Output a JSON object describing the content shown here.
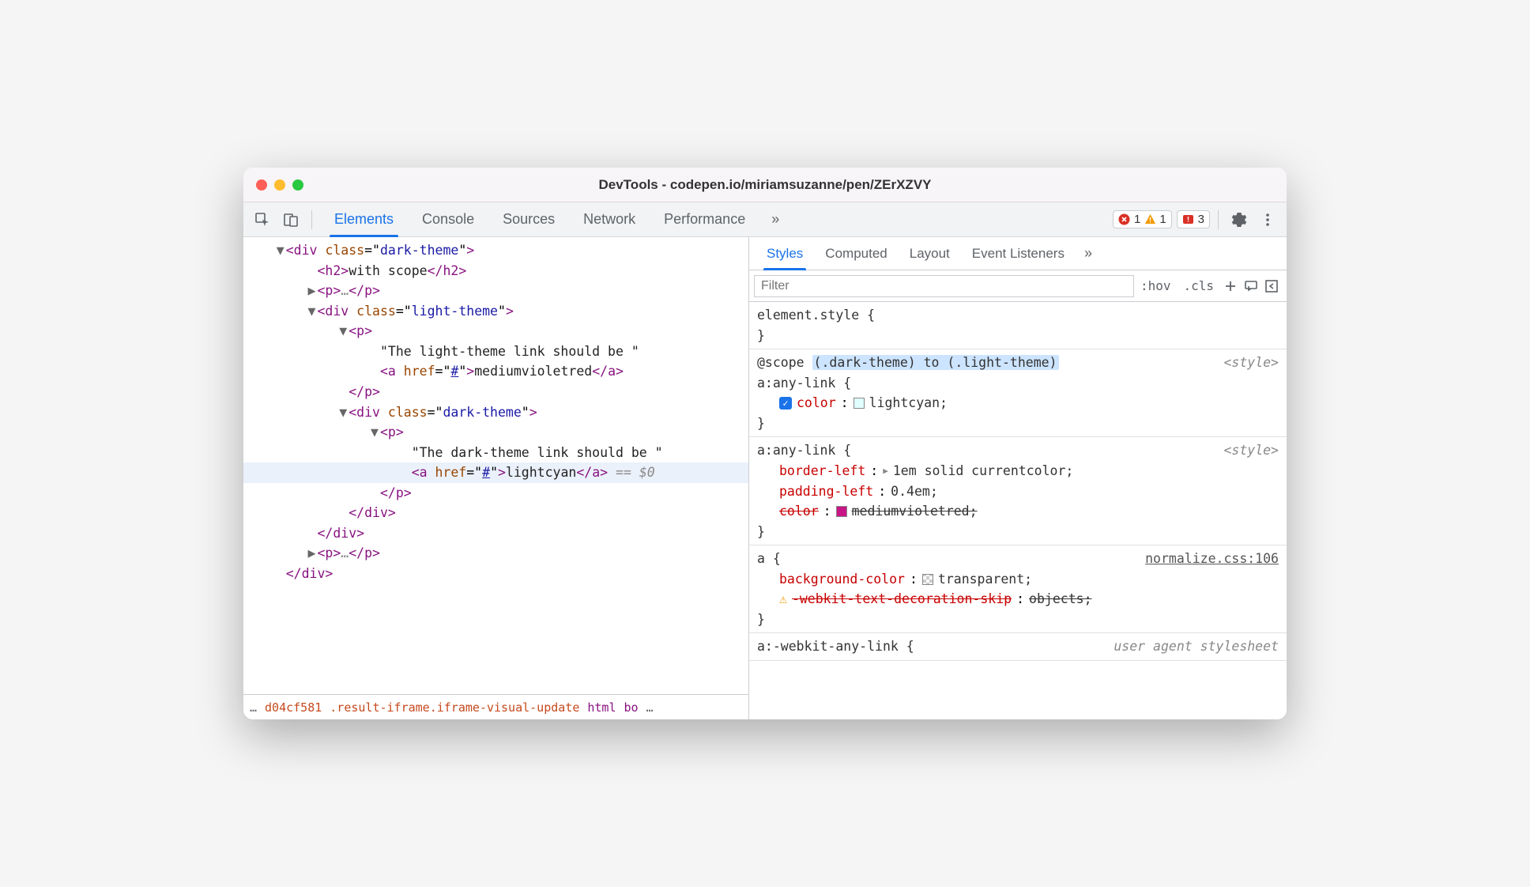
{
  "titlebar": {
    "title": "DevTools - codepen.io/miriamsuzanne/pen/ZErXZVY"
  },
  "main_tabs": [
    "Elements",
    "Console",
    "Sources",
    "Network",
    "Performance"
  ],
  "main_tab_active": 0,
  "badges": {
    "error_count": "1",
    "warning_count": "1",
    "issue_count": "3"
  },
  "dom": {
    "lines": [
      {
        "indent": 2,
        "toggle": "▼",
        "html": "<span class='tag'>&lt;div</span> <span class='attr-name'>class</span>=\"<span class='attr-val'>dark-theme</span>\"<span class='tag'>&gt;</span>"
      },
      {
        "indent": 4,
        "toggle": "",
        "html": "<span class='tag'>&lt;h2&gt;</span><span class='text-node'>with scope</span><span class='tag'>&lt;/h2&gt;</span>"
      },
      {
        "indent": 4,
        "toggle": "▶",
        "html": "<span class='tag'>&lt;p&gt;</span><span class='ellips'>…</span><span class='tag'>&lt;/p&gt;</span>"
      },
      {
        "indent": 4,
        "toggle": "▼",
        "html": "<span class='tag'>&lt;div</span> <span class='attr-name'>class</span>=\"<span class='attr-val'>light-theme</span>\"<span class='tag'>&gt;</span>"
      },
      {
        "indent": 6,
        "toggle": "▼",
        "html": "<span class='tag'>&lt;p&gt;</span>"
      },
      {
        "indent": 8,
        "toggle": "",
        "html": "<span class='text-node'>\"The light-theme link should be \"</span>"
      },
      {
        "indent": 8,
        "toggle": "",
        "html": "<span class='tag'>&lt;a</span> <span class='attr-name'>href</span>=\"<span class='attr-link'>#</span>\"<span class='tag'>&gt;</span><span class='text-node'>mediumvioletred</span><span class='tag'>&lt;/a&gt;</span>"
      },
      {
        "indent": 6,
        "toggle": "",
        "html": "<span class='tag'>&lt;/p&gt;</span>"
      },
      {
        "indent": 6,
        "toggle": "▼",
        "html": "<span class='tag'>&lt;div</span> <span class='attr-name'>class</span>=\"<span class='attr-val'>dark-theme</span>\"<span class='tag'>&gt;</span>"
      },
      {
        "indent": 8,
        "toggle": "▼",
        "html": "<span class='tag'>&lt;p&gt;</span>"
      },
      {
        "indent": 10,
        "toggle": "",
        "html": "<span class='text-node'>\"The dark-theme link should be \"</span>"
      },
      {
        "indent": 10,
        "toggle": "",
        "highlighted": true,
        "html": "<span class='tag'>&lt;a</span> <span class='attr-name'>href</span>=\"<span class='attr-link'>#</span>\"<span class='tag'>&gt;</span><span class='text-node'>lightcyan</span><span class='tag'>&lt;/a&gt;</span> <span class='eqvar'>== $0</span>"
      },
      {
        "indent": 8,
        "toggle": "",
        "html": "<span class='tag'>&lt;/p&gt;</span>"
      },
      {
        "indent": 6,
        "toggle": "",
        "html": "<span class='tag'>&lt;/div&gt;</span>"
      },
      {
        "indent": 4,
        "toggle": "",
        "html": "<span class='tag'>&lt;/div&gt;</span>"
      },
      {
        "indent": 4,
        "toggle": "▶",
        "html": "<span class='tag'>&lt;p&gt;</span><span class='ellips'>…</span><span class='tag'>&lt;/p&gt;</span>"
      },
      {
        "indent": 2,
        "toggle": "",
        "html": "<span class='tag'>&lt;/div&gt;</span>"
      }
    ]
  },
  "breadcrumb": {
    "prefix": "…",
    "items": [
      "d04cf581",
      ".result-iframe.iframe-visual-update",
      "html",
      "bo",
      "…"
    ]
  },
  "styles_tabs": [
    "Styles",
    "Computed",
    "Layout",
    "Event Listeners"
  ],
  "styles_tab_active": 0,
  "filter": {
    "placeholder": "Filter",
    "hov": ":hov",
    "cls": ".cls"
  },
  "rules": [
    {
      "selector": "element.style {",
      "source": "",
      "props": [],
      "close": "}"
    },
    {
      "prelude": "@scope ",
      "scope": "(.dark-theme) to (.light-theme)",
      "selector": "a:any-link {",
      "source": "<style>",
      "props": [
        {
          "checked": true,
          "name": "color",
          "swatch": "#e0ffff",
          "val": "lightcyan;"
        }
      ],
      "close": "}"
    },
    {
      "selector": "a:any-link {",
      "source": "<style>",
      "props": [
        {
          "name": "border-left",
          "toggle": true,
          "val": "1em solid currentcolor;"
        },
        {
          "name": "padding-left",
          "val": "0.4em;"
        },
        {
          "struck": true,
          "name": "color",
          "swatch": "#c71585",
          "val": "mediumvioletred;"
        }
      ],
      "close": "}"
    },
    {
      "selector": "a {",
      "source": "normalize.css:106",
      "source_link": true,
      "props": [
        {
          "name": "background-color",
          "swatch": "transparent",
          "val": "transparent;"
        },
        {
          "struck": true,
          "warn": true,
          "name": "-webkit-text-decoration-skip",
          "val": "objects;"
        }
      ],
      "close": "}"
    },
    {
      "selector": "a:-webkit-any-link {",
      "source": "user agent stylesheet",
      "props": [],
      "close": ""
    }
  ]
}
